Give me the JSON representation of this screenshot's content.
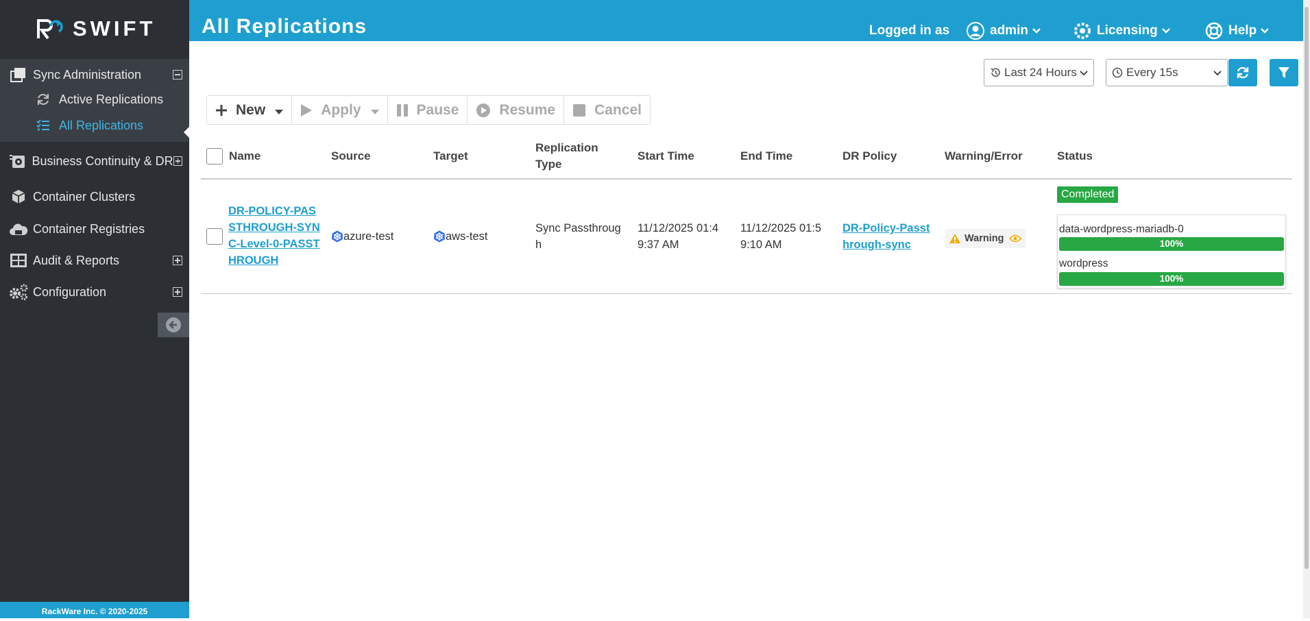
{
  "sidebar": {
    "brand": "SWIFT",
    "sync_admin": "Sync Administration",
    "sub_items": [
      "Active Replications",
      "All Replications"
    ],
    "bcdr": "Business Continuity & DR",
    "clusters": "Container Clusters",
    "registries": "Container Registries",
    "audit": "Audit & Reports",
    "configuration": "Configuration",
    "footer": "RackWare Inc. © 2020-2025"
  },
  "header": {
    "title": "All Replications",
    "logged_in_as": "Logged in as",
    "user": "admin",
    "licensing": "Licensing",
    "help": "Help"
  },
  "controls": {
    "time_range": "Last 24 Hours",
    "refresh_interval": "Every 15s"
  },
  "toolbar": {
    "new": "New",
    "apply": "Apply",
    "pause": "Pause",
    "resume": "Resume",
    "cancel": "Cancel"
  },
  "table": {
    "columns": [
      "Name",
      "Source",
      "Target",
      "Replication Type",
      "Start Time",
      "End Time",
      "DR Policy",
      "Warning/Error",
      "Status"
    ],
    "rows": [
      {
        "name": "DR-POLICY-PASSTHROUGH-SYNC-Level-0-PASSTHROUGH",
        "source": "azure-test",
        "target": "aws-test",
        "type": "Sync Passthrough",
        "start_time": "11/12/2025 01:49:37 AM",
        "end_time": "11/12/2025 01:59:10 AM",
        "dr_policy": "DR-Policy-Passthrough-sync",
        "warning": "Warning",
        "status": "Completed",
        "progress": [
          {
            "name": "data-wordpress-mariadb-0",
            "value": 100,
            "label": "100%"
          },
          {
            "name": "wordpress",
            "value": 100,
            "label": "100%"
          }
        ]
      }
    ]
  },
  "colors": {
    "accent": "#1e9fd0",
    "sidebar": "#2c3035",
    "success": "#28a745",
    "warning": "#f0ad00"
  }
}
